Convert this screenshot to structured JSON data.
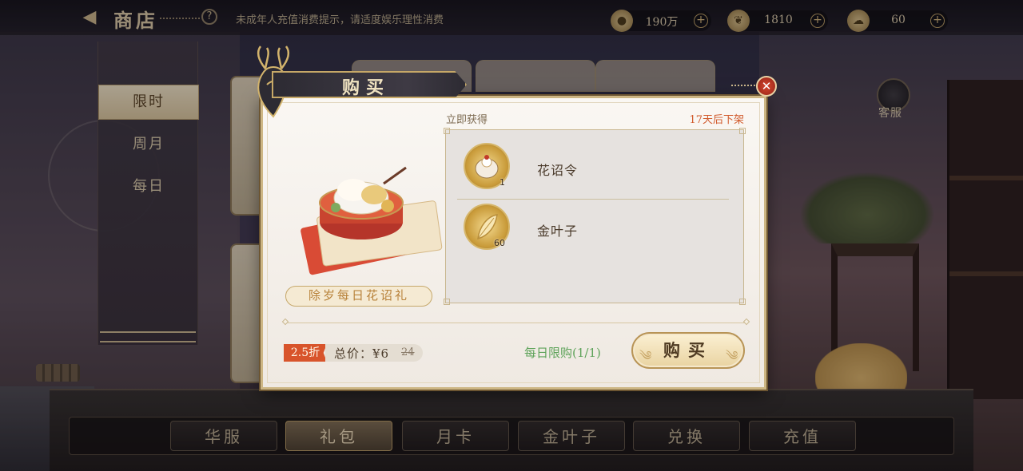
{
  "topbar": {
    "title": "商店",
    "notice": "未成年人充值消费提示，请适度娱乐理性消费",
    "currencies": [
      {
        "icon": "coin-icon",
        "value": "190万"
      },
      {
        "icon": "leaf-icon",
        "value": "1810"
      },
      {
        "icon": "cloud-token-icon",
        "value": "60"
      }
    ]
  },
  "side_tabs": [
    {
      "label": "限时",
      "active": true
    },
    {
      "label": "周月",
      "active": false
    },
    {
      "label": "每日",
      "active": false
    }
  ],
  "bottom_tabs": [
    {
      "label": "华服",
      "active": false
    },
    {
      "label": "礼包",
      "active": true
    },
    {
      "label": "月卡",
      "active": false
    },
    {
      "label": "金叶子",
      "active": false
    },
    {
      "label": "兑换",
      "active": false
    },
    {
      "label": "充值",
      "active": false
    }
  ],
  "service": {
    "label": "客服"
  },
  "dialog": {
    "title": "购买",
    "gift_name": "除岁每日花诏礼",
    "immediate_label": "立即获得",
    "expire_label": "17天后下架",
    "items": [
      {
        "name": "花诏令",
        "count": "1",
        "icon": "flower-token-icon"
      },
      {
        "name": "金叶子",
        "count": "60",
        "icon": "gold-leaf-icon"
      }
    ],
    "discount": "2.5折",
    "total_label": "总价：¥6",
    "original_price": "24",
    "daily_limit": "每日限购(1/1)",
    "buy_label": "购买"
  },
  "colors": {
    "accent_gold": "#c6a867",
    "discount_red": "#d8542b",
    "limit_green": "#5ea35a"
  }
}
